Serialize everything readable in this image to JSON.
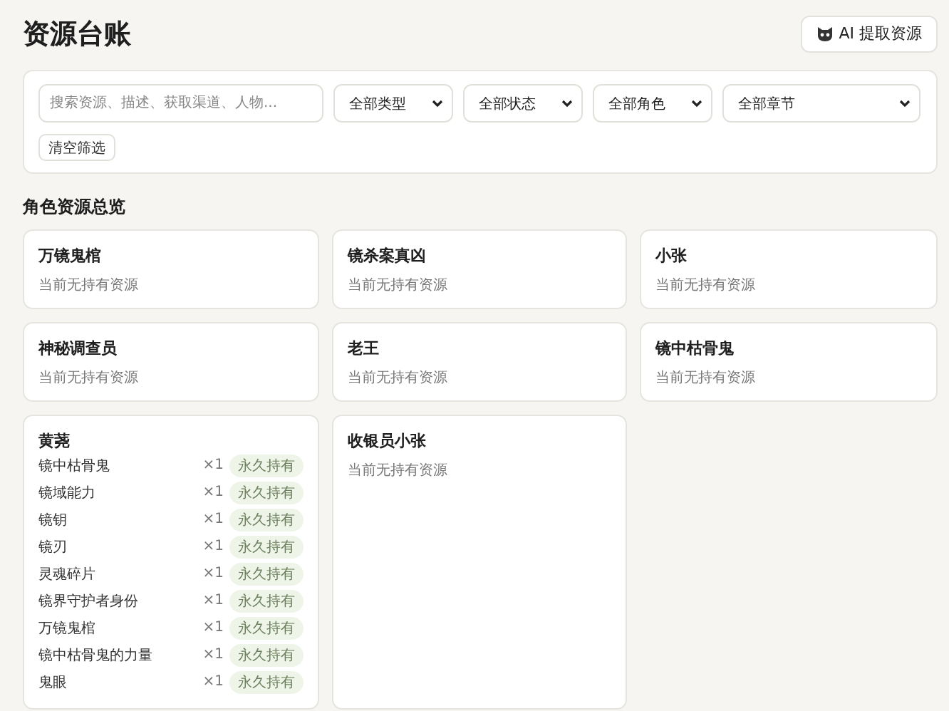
{
  "page_title": "资源台账",
  "extract_button": {
    "label": "AI 提取资源"
  },
  "filters": {
    "search": {
      "placeholder": "搜索资源、描述、获取渠道、人物..."
    },
    "dropdowns": [
      {
        "value": "全部类型"
      },
      {
        "value": "全部状态"
      },
      {
        "value": "全部角色"
      },
      {
        "value": "全部章节"
      }
    ],
    "clear_button": {
      "label": "清空筛选"
    }
  },
  "section_title": "角色资源总览",
  "characters": [
    {
      "name": "万镜鬼棺",
      "empty_text": "当前无持有资源"
    },
    {
      "name": "镜杀案真凶",
      "empty_text": "当前无持有资源"
    },
    {
      "name": "小张",
      "empty_text": "当前无持有资源"
    },
    {
      "name": "神秘调查员",
      "empty_text": "当前无持有资源"
    },
    {
      "name": "老王",
      "empty_text": "当前无持有资源"
    },
    {
      "name": "镜中枯骨鬼",
      "empty_text": "当前无持有资源"
    },
    {
      "name": "黄荛",
      "resources": [
        {
          "name": "镜中枯骨鬼",
          "count": "×1",
          "status": "永久持有"
        },
        {
          "name": "镜域能力",
          "count": "×1",
          "status": "永久持有"
        },
        {
          "name": "镜钥",
          "count": "×1",
          "status": "永久持有"
        },
        {
          "name": "镜刃",
          "count": "×1",
          "status": "永久持有"
        },
        {
          "name": "灵魂碎片",
          "count": "×1",
          "status": "永久持有"
        },
        {
          "name": "镜界守护者身份",
          "count": "×1",
          "status": "永久持有"
        },
        {
          "name": "万镜鬼棺",
          "count": "×1",
          "status": "永久持有"
        },
        {
          "name": "镜中枯骨鬼的力量",
          "count": "×1",
          "status": "永久持有"
        },
        {
          "name": "鬼眼",
          "count": "×1",
          "status": "永久持有"
        }
      ]
    },
    {
      "name": "收银员小张",
      "empty_text": "当前无持有资源"
    }
  ]
}
